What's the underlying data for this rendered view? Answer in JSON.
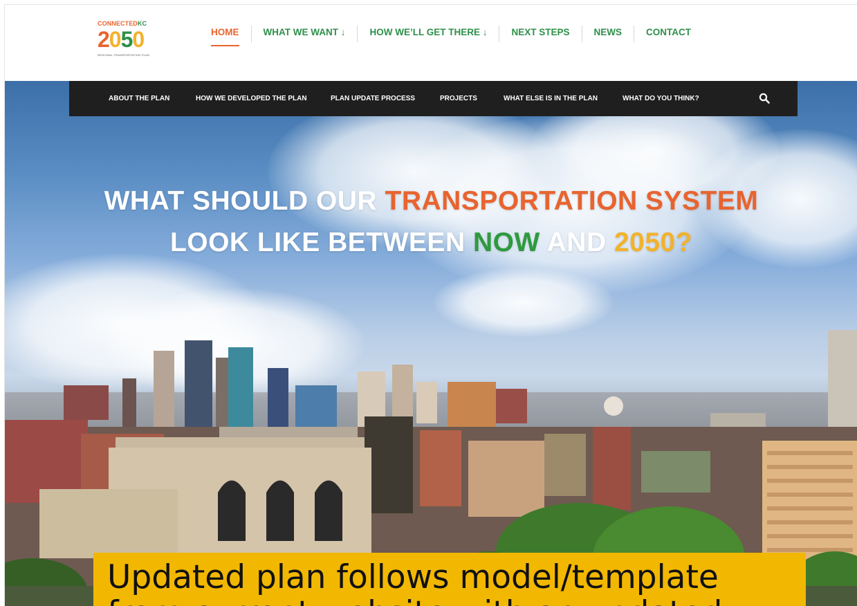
{
  "logo": {
    "line1_a": "CONNECTED",
    "line1_b": "KC",
    "year_digits": [
      "2",
      "0",
      "5",
      "0"
    ],
    "line3": "REGIONAL TRANSPORTATION PLAN"
  },
  "main_nav": [
    {
      "label": "HOME",
      "active": true
    },
    {
      "label": "WHAT WE WANT ↓"
    },
    {
      "label": "HOW WE’LL GET THERE ↓"
    },
    {
      "label": "NEXT STEPS"
    },
    {
      "label": "NEWS"
    },
    {
      "label": "CONTACT"
    }
  ],
  "sub_nav": [
    {
      "label": "ABOUT THE PLAN"
    },
    {
      "label": "HOW WE DEVELOPED THE PLAN"
    },
    {
      "label": "PLAN UPDATE PROCESS"
    },
    {
      "label": "PROJECTS"
    },
    {
      "label": "WHAT ELSE IS IN THE PLAN"
    },
    {
      "label": "WHAT DO YOU THINK?"
    }
  ],
  "search_icon": "magnifier-icon",
  "headline": {
    "line1_a": "WHAT SHOULD OUR ",
    "line1_b": "TRANSPORTATION SYSTEM",
    "line2_a": "LOOK LIKE BETWEEN ",
    "line2_b": "NOW",
    "line2_c": " AND ",
    "line2_d": "2050?"
  },
  "caption": "Updated plan follows model/template from current website with an updated",
  "colors": {
    "brand_orange": "#e8642f",
    "brand_green": "#2e8f4a",
    "brand_yellow": "#f2b22c",
    "subnav_bg": "#1f1f1f",
    "caption_bg": "#f2b700"
  }
}
